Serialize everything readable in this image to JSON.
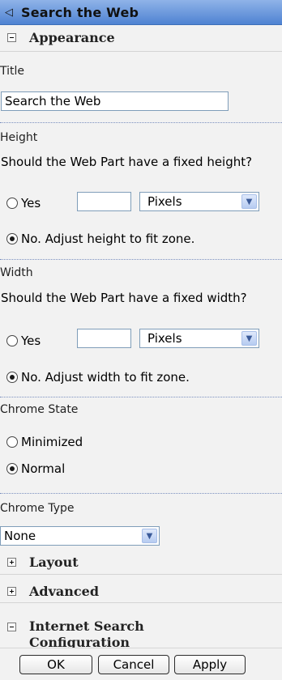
{
  "title": "Search the Web",
  "appearance": {
    "header": "Appearance",
    "title_label": "Title",
    "title_value": "Search the Web",
    "height": {
      "label": "Height",
      "question": "Should the Web Part have a fixed height?",
      "yes_label": "Yes",
      "unit": "Pixels",
      "no_label": "No. Adjust height to fit zone.",
      "selected": "no"
    },
    "width": {
      "label": "Width",
      "question": "Should the Web Part have a fixed width?",
      "yes_label": "Yes",
      "unit": "Pixels",
      "no_label": "No. Adjust width to fit zone.",
      "selected": "no"
    },
    "chrome_state": {
      "label": "Chrome State",
      "minimized_label": "Minimized",
      "normal_label": "Normal",
      "selected": "normal"
    },
    "chrome_type": {
      "label": "Chrome Type",
      "value": "None"
    }
  },
  "sections": {
    "layout": "Layout",
    "advanced": "Advanced",
    "internet_search": "Internet Search Configuration"
  },
  "buttons": {
    "ok": "OK",
    "cancel": "Cancel",
    "apply": "Apply"
  }
}
